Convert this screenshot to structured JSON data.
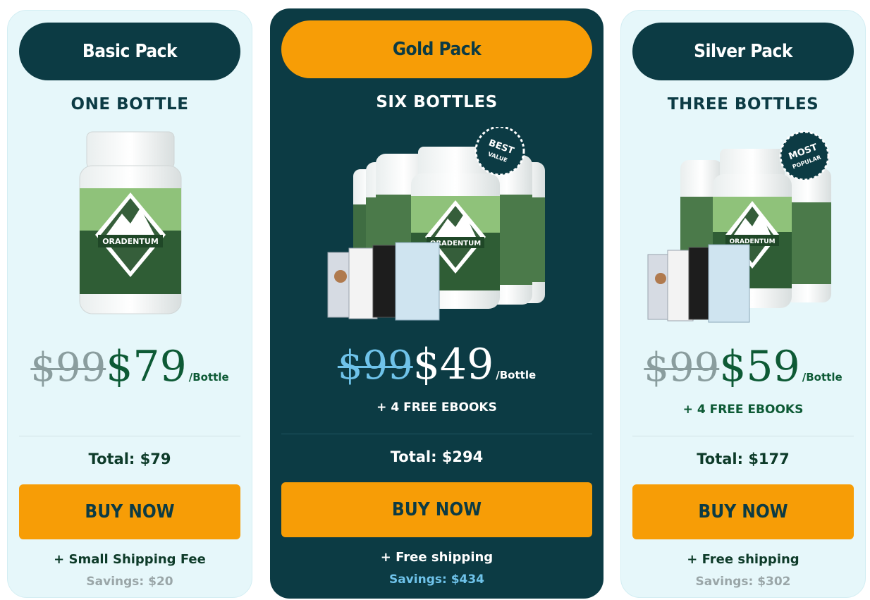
{
  "colors": {
    "dark_teal": "#0c3b44",
    "orange": "#f79d06",
    "light_bg": "#e6f7fa",
    "green_price": "#0d5a35",
    "sky_blue": "#6fc3ea"
  },
  "packs": [
    {
      "pack_label": "Basic Pack",
      "quantity": "ONE BOTTLE",
      "brand_text": "ORADENTUM",
      "old_price": "$99",
      "new_price": "$79",
      "per_unit": "/Bottle",
      "ebooks": "",
      "total": "Total: $79",
      "buy_label": "BUY NOW",
      "shipping": "+ Small Shipping Fee",
      "savings": "Savings: $20"
    },
    {
      "pack_label": "Gold Pack",
      "quantity": "SIX BOTTLES",
      "brand_text": "ORADENTUM",
      "badge_line1": "BEST",
      "badge_line2": "VALUE",
      "old_price": "$99",
      "new_price": "$49",
      "per_unit": "/Bottle",
      "ebooks": "+ 4 FREE EBOOKS",
      "total": "Total: $294",
      "buy_label": "BUY NOW",
      "shipping": "+ Free shipping",
      "savings": "Savings: $434"
    },
    {
      "pack_label": "Silver Pack",
      "quantity": "THREE BOTTLES",
      "brand_text": "ORADENTUM",
      "badge_line1": "MOST",
      "badge_line2": "POPULAR",
      "old_price": "$99",
      "new_price": "$59",
      "per_unit": "/Bottle",
      "ebooks": "+ 4 FREE EBOOKS",
      "total": "Total: $177",
      "buy_label": "BUY NOW",
      "shipping": "+ Free shipping",
      "savings": "Savings: $302"
    }
  ]
}
